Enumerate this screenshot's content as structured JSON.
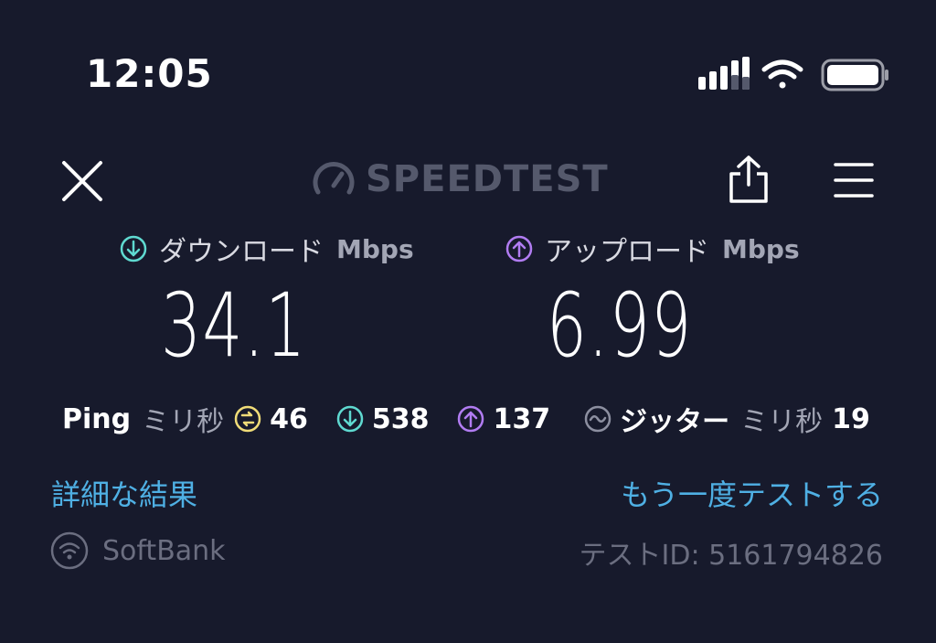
{
  "status_bar": {
    "time": "12:05",
    "cellular_icon": "cellular-signal-icon",
    "wifi_icon": "wifi-icon",
    "battery_icon": "battery-icon"
  },
  "header": {
    "close_icon": "close-icon",
    "logo_text": "SPEEDTEST",
    "share_icon": "share-icon",
    "menu_icon": "hamburger-menu-icon"
  },
  "download": {
    "label": "ダウンロード",
    "unit": "Mbps",
    "value": "34.1",
    "icon": "download-arrow-icon",
    "color": "#5fd9d0"
  },
  "upload": {
    "label": "アップロード",
    "unit": "Mbps",
    "value": "6.99",
    "icon": "upload-arrow-icon",
    "color": "#b17cf2"
  },
  "ping": {
    "label": "Ping",
    "unit": "ミリ秒",
    "idle_value": "46",
    "idle_color": "#f0dc78",
    "download_value": "538",
    "upload_value": "137"
  },
  "jitter": {
    "label": "ジッター",
    "unit": "ミリ秒",
    "value": "19",
    "icon": "jitter-wave-icon"
  },
  "links": {
    "details": "詳細な結果",
    "retest": "もう一度テストする"
  },
  "footer": {
    "isp": "SoftBank",
    "isp_icon": "wifi-circle-icon",
    "test_id": "テストID: 5161794826"
  }
}
